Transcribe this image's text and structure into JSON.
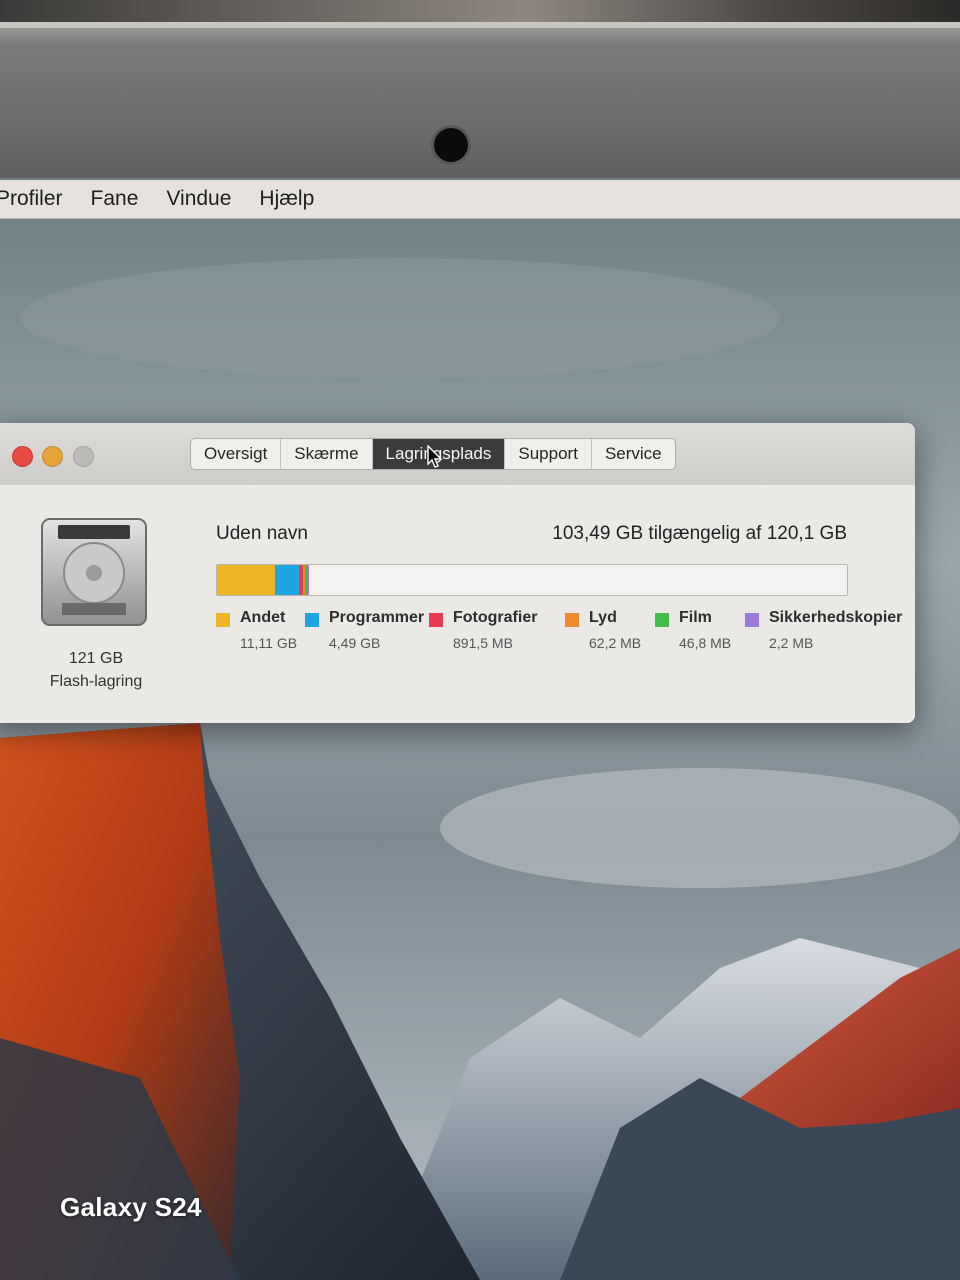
{
  "menubar": {
    "items": [
      "Profiler",
      "Fane",
      "Vindue",
      "Hjælp"
    ]
  },
  "window": {
    "tabs": [
      {
        "label": "Oversigt",
        "active": false
      },
      {
        "label": "Skærme",
        "active": false
      },
      {
        "label": "Lagringsplads",
        "active": true
      },
      {
        "label": "Support",
        "active": false
      },
      {
        "label": "Service",
        "active": false
      }
    ],
    "disk": {
      "icon": "hard-disk-icon",
      "size": "121 GB",
      "type": "Flash-lagring"
    },
    "volume": {
      "name": "Uden navn",
      "available": "103,49 GB tilgængelig af 120,1 GB",
      "total_gb": 120.1,
      "categories": [
        {
          "name": "Andet",
          "size": "11,11 GB",
          "gb": 11.11,
          "color": "#f0b429"
        },
        {
          "name": "Programmer",
          "size": "4,49 GB",
          "gb": 4.49,
          "color": "#1ea4e0"
        },
        {
          "name": "Fotografier",
          "size": "891,5 MB",
          "gb": 0.89,
          "color": "#e83b4f"
        },
        {
          "name": "Lyd",
          "size": "62,2 MB",
          "gb": 0.06,
          "color": "#f2892a"
        },
        {
          "name": "Film",
          "size": "46,8 MB",
          "gb": 0.05,
          "color": "#3fbf4a"
        },
        {
          "name": "Sikkerhedskopier",
          "size": "2,2 MB",
          "gb": 0.002,
          "color": "#9a79d8"
        }
      ]
    }
  },
  "watermark": "Galaxy S24"
}
